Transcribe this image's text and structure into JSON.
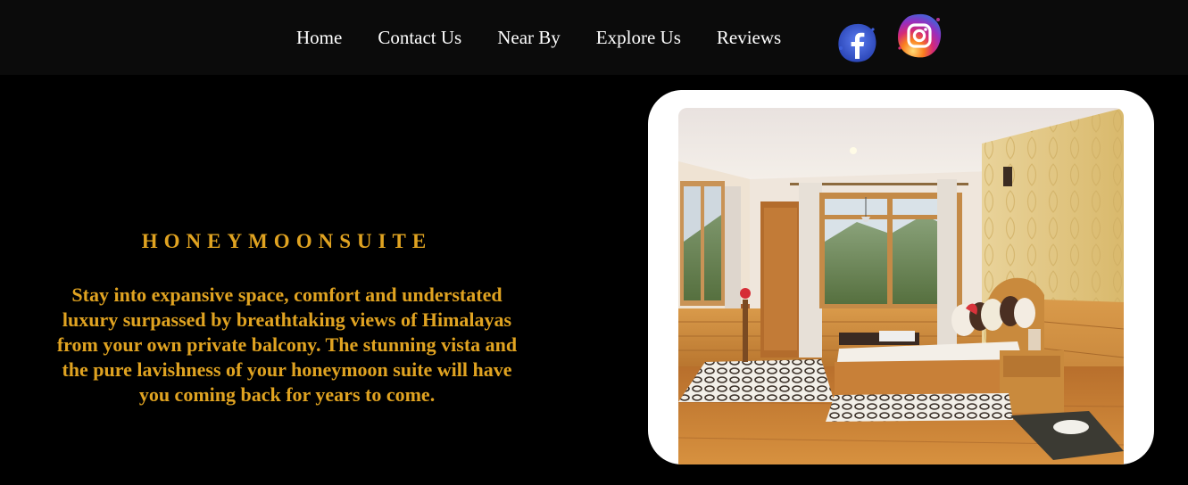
{
  "nav": {
    "items": [
      {
        "label": "Home"
      },
      {
        "label": "Contact Us"
      },
      {
        "label": "Near By"
      },
      {
        "label": "Explore Us"
      },
      {
        "label": "Reviews"
      }
    ],
    "social": [
      {
        "icon": "facebook-icon",
        "color": "#3b5bdb"
      },
      {
        "icon": "instagram-icon",
        "color": "#c13584"
      }
    ]
  },
  "suite": {
    "title": "HONEYMOONSUITE",
    "description": "Stay into expansive space, comfort and understated luxury surpassed by breathtaking views of Himalayas from your own private balcony. The stunning vista and the pure lavishness of your honeymoon suite will have you coming back for years to come."
  },
  "colors": {
    "accent": "#e0a321",
    "background": "#000000",
    "navbar": "#0b0b0b"
  }
}
